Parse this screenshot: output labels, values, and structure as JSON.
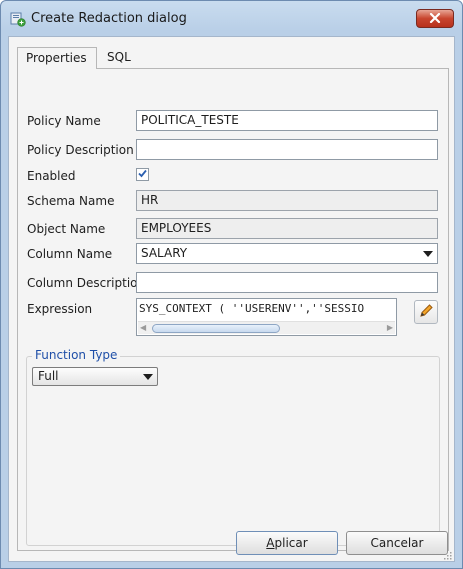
{
  "window": {
    "title": "Create Redaction dialog"
  },
  "tabs": [
    {
      "label": "Properties",
      "active": true
    },
    {
      "label": "SQL",
      "active": false
    }
  ],
  "form": {
    "policy_name": {
      "label": "Policy Name",
      "value": "POLITICA_TESTE"
    },
    "policy_description": {
      "label": "Policy Description",
      "value": ""
    },
    "enabled": {
      "label": "Enabled",
      "checked": true
    },
    "schema_name": {
      "label": "Schema Name",
      "value": "HR"
    },
    "object_name": {
      "label": "Object Name",
      "value": "EMPLOYEES"
    },
    "column_name": {
      "label": "Column Name",
      "value": "SALARY"
    },
    "column_description": {
      "label": "Column Description",
      "value": ""
    },
    "expression": {
      "label": "Expression",
      "value": "SYS_CONTEXT ( ''USERENV'',''SESSIO"
    }
  },
  "function_type": {
    "legend": "Function Type",
    "value": "Full"
  },
  "buttons": {
    "apply_mnemonic": "A",
    "apply_rest": "plicar",
    "cancel": "Cancelar"
  },
  "colors": {
    "legend": "#1f4fa8",
    "close_button": "#c8452e",
    "titlebar": "#b9cfe7"
  },
  "icons": [
    "app-icon",
    "close-icon",
    "checkmark-icon",
    "pencil-icon",
    "chevron-down-icon",
    "scroll-left-icon",
    "scroll-right-icon",
    "resize-grip-icon"
  ]
}
